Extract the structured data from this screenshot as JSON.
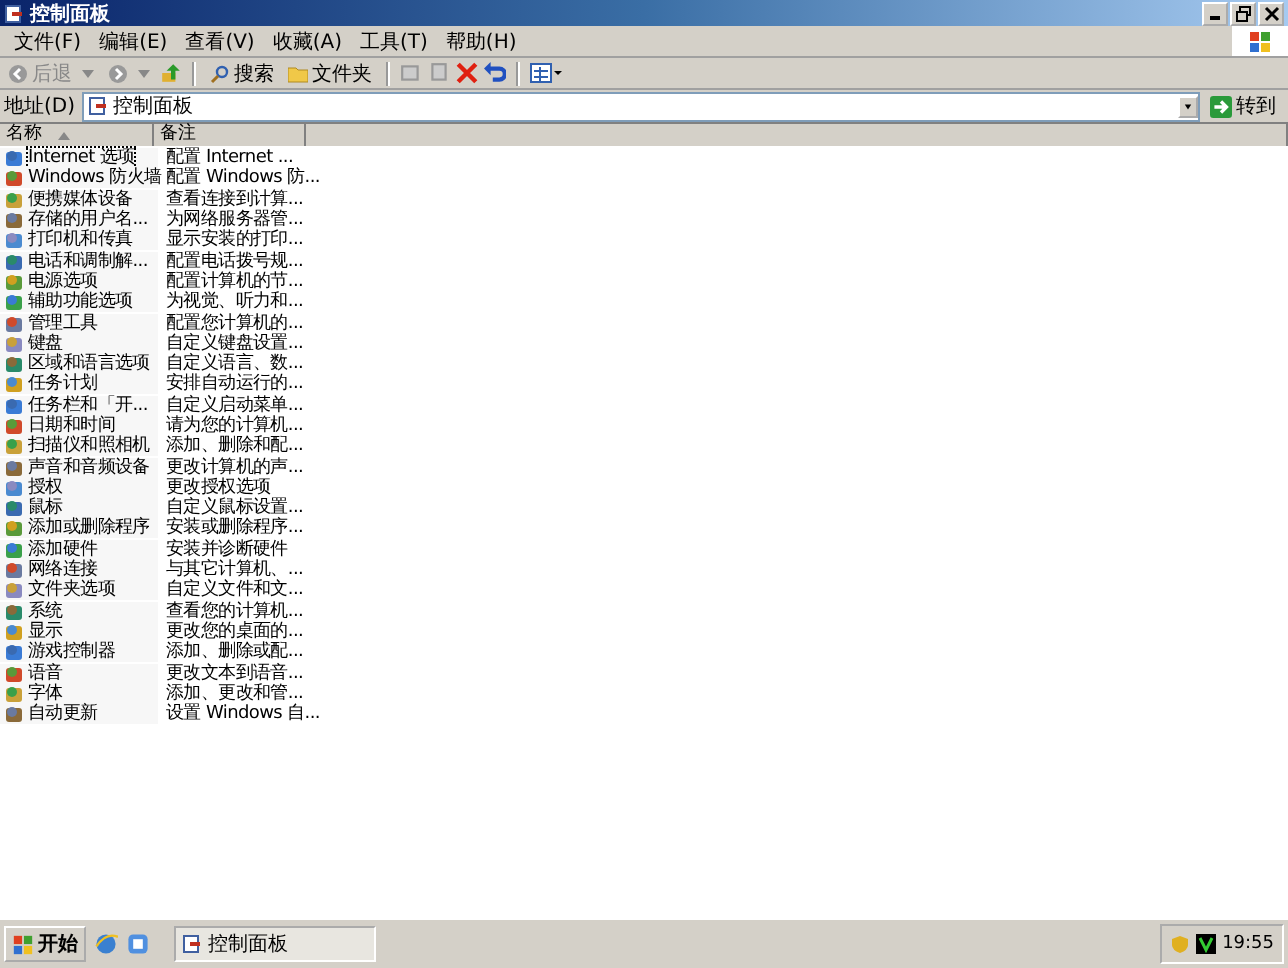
{
  "window": {
    "title": "控制面板"
  },
  "menu": [
    "文件(F)",
    "编辑(E)",
    "查看(V)",
    "收藏(A)",
    "工具(T)",
    "帮助(H)"
  ],
  "toolbar": {
    "back": "后退",
    "search": "搜索",
    "folders": "文件夹"
  },
  "address": {
    "label": "地址(D)",
    "value": "控制面板",
    "go": "转到"
  },
  "columns": [
    "名称",
    "备注"
  ],
  "items": [
    {
      "name": "Internet 选项",
      "comment": "配置 Internet ...",
      "selected": true
    },
    {
      "name": "Windows 防火墙",
      "comment": "配置 Windows 防...",
      "selected": false
    },
    {
      "name": "便携媒体设备",
      "comment": "查看连接到计算...",
      "selected": false
    },
    {
      "name": "存储的用户名...",
      "comment": "为网络服务器管...",
      "selected": false
    },
    {
      "name": "打印机和传真",
      "comment": "显示安装的打印...",
      "selected": false
    },
    {
      "name": "电话和调制解...",
      "comment": "配置电话拨号规...",
      "selected": false
    },
    {
      "name": "电源选项",
      "comment": "配置计算机的节...",
      "selected": false
    },
    {
      "name": "辅助功能选项",
      "comment": "为视觉、听力和...",
      "selected": false
    },
    {
      "name": "管理工具",
      "comment": "配置您计算机的...",
      "selected": false
    },
    {
      "name": "键盘",
      "comment": "自定义键盘设置...",
      "selected": false
    },
    {
      "name": "区域和语言选项",
      "comment": "自定义语言、数...",
      "selected": false
    },
    {
      "name": "任务计划",
      "comment": "安排自动运行的...",
      "selected": false
    },
    {
      "name": "任务栏和「开...",
      "comment": "自定义启动菜单...",
      "selected": false
    },
    {
      "name": "日期和时间",
      "comment": "请为您的计算机...",
      "selected": false
    },
    {
      "name": "扫描仪和照相机",
      "comment": "添加、删除和配...",
      "selected": false
    },
    {
      "name": "声音和音频设备",
      "comment": "更改计算机的声...",
      "selected": false
    },
    {
      "name": "授权",
      "comment": "更改授权选项",
      "selected": false
    },
    {
      "name": "鼠标",
      "comment": "自定义鼠标设置...",
      "selected": false
    },
    {
      "name": "添加或删除程序",
      "comment": "安装或删除程序...",
      "selected": false
    },
    {
      "name": "添加硬件",
      "comment": "安装并诊断硬件",
      "selected": false
    },
    {
      "name": "网络连接",
      "comment": "与其它计算机、...",
      "selected": false
    },
    {
      "name": "文件夹选项",
      "comment": "自定义文件和文...",
      "selected": false
    },
    {
      "name": "系统",
      "comment": "查看您的计算机...",
      "selected": false
    },
    {
      "name": "显示",
      "comment": "更改您的桌面的...",
      "selected": false
    },
    {
      "name": "游戏控制器",
      "comment": "添加、删除或配...",
      "selected": false
    },
    {
      "name": "语音",
      "comment": "更改文本到语音...",
      "selected": false
    },
    {
      "name": "字体",
      "comment": "添加、更改和管...",
      "selected": false
    },
    {
      "name": "自动更新",
      "comment": "设置 Windows 自...",
      "selected": false
    }
  ],
  "taskbar": {
    "start": "开始",
    "task": "控制面板",
    "clock": "19:55"
  }
}
